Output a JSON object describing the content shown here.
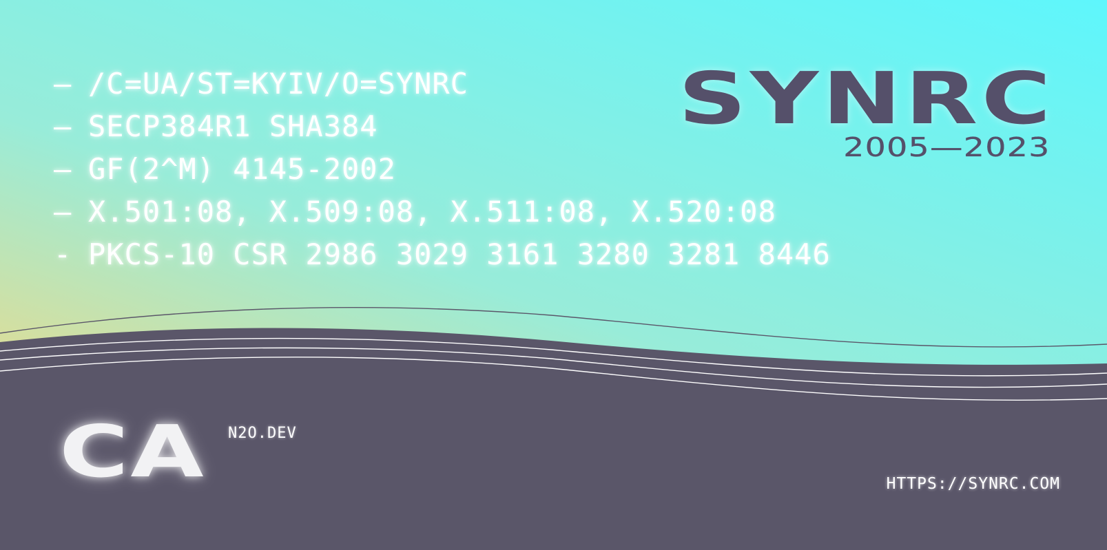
{
  "background": {
    "gradient_start_color": "#e3dc93",
    "gradient_mid_color": "#98ecd9",
    "gradient_end_color": "#5ef6fc",
    "lower_panel_color": "#5a5669",
    "wave_line_color": "#ffffff"
  },
  "spec_lines": [
    {
      "dash": "—",
      "text": "/C=UA/ST=KYIV/O=SYNRC"
    },
    {
      "dash": "—",
      "text": "SECP384R1 SHA384"
    },
    {
      "dash": "—",
      "text": "GF(2^M) 4145-2002"
    },
    {
      "dash": "—",
      "text": "X.501:08, X.509:08, X.511:08, X.520:08"
    },
    {
      "dash": "-",
      "text": "PKCS-10 CSR 2986 3029 3161 3280 3281 8446"
    }
  ],
  "brand": {
    "name": "SYNRC",
    "years": "2005—2023",
    "color": "#55506a"
  },
  "product": {
    "title": "CA",
    "domain": "N2O.DEV"
  },
  "footer": {
    "url": "HTTPS://SYNRC.COM"
  }
}
